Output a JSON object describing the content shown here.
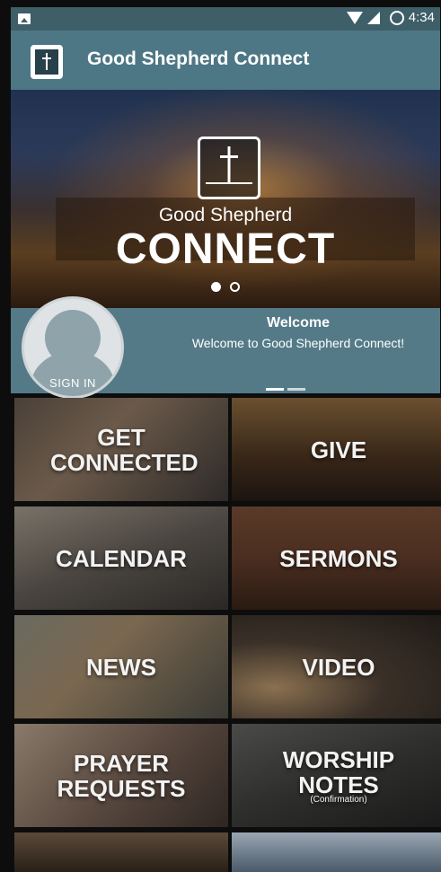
{
  "status_bar": {
    "time": "4:34"
  },
  "app_bar": {
    "title": "Good Shepherd Connect"
  },
  "hero": {
    "subtitle": "Good Shepherd",
    "title": "CONNECT"
  },
  "welcome": {
    "title": "Welcome",
    "message": "Welcome to Good Shepherd Connect!",
    "sign_in": "SIGN IN"
  },
  "tiles": [
    {
      "label": "GET CONNECTED",
      "note": ""
    },
    {
      "label": "GIVE",
      "note": ""
    },
    {
      "label": "CALENDAR",
      "note": ""
    },
    {
      "label": "SERMONS",
      "note": ""
    },
    {
      "label": "NEWS",
      "note": ""
    },
    {
      "label": "VIDEO",
      "note": ""
    },
    {
      "label": "PRAYER REQUESTS",
      "note": ""
    },
    {
      "label": "WORSHIP NOTES",
      "note": "(Confirmation)"
    }
  ],
  "colors": {
    "app_bar": "#4e7785",
    "status_bar": "#3e5e68",
    "welcome_panel": "#547a87"
  }
}
